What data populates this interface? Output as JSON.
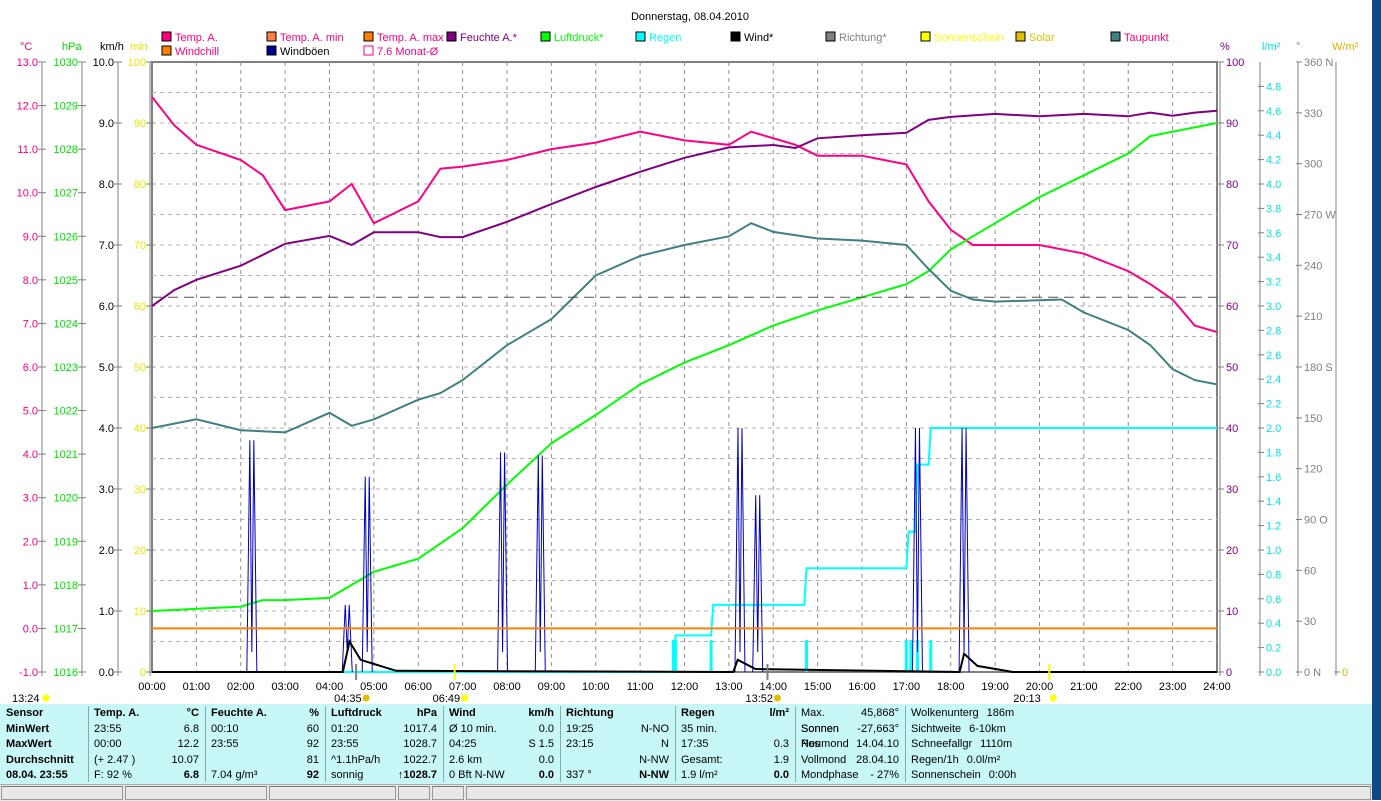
{
  "chart_data": {
    "type": "line",
    "title": "Donnerstag, 08.04.2010",
    "legend": [
      {
        "label": "Temp. A.",
        "color": "#ff0080",
        "text": "#ff0080"
      },
      {
        "label": "Temp. A. min",
        "color": "#ff8040",
        "text": "#ff0080"
      },
      {
        "label": "Temp. A. max",
        "color": "#ff8000",
        "text": "#ff0080"
      },
      {
        "label": "Feuchte A.*",
        "color": "#800080",
        "text": "#800080"
      },
      {
        "label": "Luftdruck*",
        "color": "#00ff00",
        "text": "#00ff00"
      },
      {
        "label": "Regen",
        "color": "#00ffff",
        "text": "#00ffff"
      },
      {
        "label": "Wind*",
        "color": "#000000",
        "text": "#000000"
      },
      {
        "label": "Richtung*",
        "color": "#808080",
        "text": "#808080"
      },
      {
        "label": "Sonnenschein",
        "color": "#ffff00",
        "text": "#ffff00"
      },
      {
        "label": "Solar",
        "color": "#e0c000",
        "text": "#e0c000"
      },
      {
        "label": "Taupunkt",
        "color": "#408080",
        "text": "#ff0080"
      },
      {
        "label": "Windchill",
        "color": "#ff8000",
        "text": "#ff0080"
      },
      {
        "label": "Windböen",
        "color": "#000090",
        "text": "#000000"
      },
      {
        "label": "7.6 Monat-Ø",
        "color": "#ff0080",
        "text": "#ff0080",
        "hollow": true
      }
    ],
    "x_ticks": [
      "00:00",
      "01:00",
      "02:00",
      "03:00",
      "04:00",
      "05:00",
      "06:00",
      "07:00",
      "08:00",
      "09:00",
      "10:00",
      "11:00",
      "12:00",
      "13:00",
      "14:00",
      "15:00",
      "16:00",
      "17:00",
      "18:00",
      "19:00",
      "20:00",
      "21:00",
      "22:00",
      "23:00",
      "24:00"
    ],
    "xlim": [
      0,
      24
    ],
    "axes_left": [
      {
        "unit": "°C",
        "color": "#ff0080",
        "range": [
          -1,
          13
        ],
        "ticks": [
          "-1.0",
          "0.0",
          "1.0",
          "2.0",
          "3.0",
          "4.0",
          "5.0",
          "6.0",
          "7.0",
          "8.0",
          "9.0",
          "10.0",
          "11.0",
          "12.0",
          "13.0"
        ]
      },
      {
        "unit": "hPa",
        "color": "#00e000",
        "range": [
          1016,
          1030
        ],
        "ticks": [
          "1016",
          "1017",
          "1018",
          "1019",
          "1020",
          "1021",
          "1022",
          "1023",
          "1024",
          "1025",
          "1026",
          "1027",
          "1028",
          "1029",
          "1030"
        ]
      },
      {
        "unit": "km/h",
        "color": "#000000",
        "range": [
          0,
          10
        ],
        "ticks": [
          "0.0",
          "1.0",
          "2.0",
          "3.0",
          "4.0",
          "5.0",
          "6.0",
          "7.0",
          "8.0",
          "9.0",
          "10.0"
        ]
      },
      {
        "unit": "min",
        "color": "#e8e800",
        "range": [
          0,
          100
        ],
        "ticks": [
          "0",
          "10",
          "20",
          "30",
          "40",
          "50",
          "60",
          "70",
          "80",
          "90",
          "100"
        ]
      }
    ],
    "axes_right": [
      {
        "unit": "%",
        "color": "#800080",
        "range": [
          0,
          100
        ],
        "ticks": [
          "0",
          "10",
          "20",
          "30",
          "40",
          "50",
          "60",
          "70",
          "80",
          "90",
          "100"
        ]
      },
      {
        "unit": "l/m²",
        "color": "#00e8e8",
        "range": [
          0,
          5
        ],
        "ticks": [
          "0.0",
          "0.2",
          "0.4",
          "0.6",
          "0.8",
          "1.0",
          "1.2",
          "1.4",
          "1.6",
          "1.8",
          "2.0",
          "2.2",
          "2.4",
          "2.6",
          "2.8",
          "3.0",
          "3.2",
          "3.4",
          "3.6",
          "3.8",
          "4.0",
          "4.2",
          "4.4",
          "4.6",
          "4.8"
        ]
      },
      {
        "unit": "°",
        "color": "#808080",
        "range": [
          0,
          360
        ],
        "ticks": [
          "0 N",
          "30",
          "60",
          "90 O",
          "120",
          "150",
          "180 S",
          "210",
          "240",
          "270 W",
          "300",
          "330",
          "360 N"
        ]
      },
      {
        "unit": "W/m²",
        "color": "#e0b000",
        "range": [
          0,
          100
        ],
        "ticks": [
          "0"
        ]
      }
    ],
    "series": [
      {
        "name": "Temp. A.",
        "axis": "°C",
        "color": "#ff0080",
        "points": [
          [
            0,
            12.2
          ],
          [
            0.5,
            11.55
          ],
          [
            1,
            11.1
          ],
          [
            2,
            10.75
          ],
          [
            2.5,
            10.4
          ],
          [
            3,
            9.6
          ],
          [
            4,
            9.8
          ],
          [
            4.5,
            10.2
          ],
          [
            5,
            9.3
          ],
          [
            6,
            9.8
          ],
          [
            6.5,
            10.55
          ],
          [
            7,
            10.6
          ],
          [
            8,
            10.75
          ],
          [
            9,
            11.0
          ],
          [
            10,
            11.15
          ],
          [
            11,
            11.4
          ],
          [
            12,
            11.2
          ],
          [
            13,
            11.1
          ],
          [
            13.5,
            11.4
          ],
          [
            14.5,
            11.1
          ],
          [
            15,
            10.85
          ],
          [
            16,
            10.85
          ],
          [
            17,
            10.65
          ],
          [
            17.5,
            9.8
          ],
          [
            18,
            9.15
          ],
          [
            18.5,
            8.8
          ],
          [
            20,
            8.8
          ],
          [
            21,
            8.6
          ],
          [
            22,
            8.2
          ],
          [
            22.5,
            7.9
          ],
          [
            23,
            7.55
          ],
          [
            23.5,
            6.95
          ],
          [
            24,
            6.8
          ]
        ]
      },
      {
        "name": "Feuchte A.*",
        "axis": "%",
        "color": "#800080",
        "points": [
          [
            0,
            60
          ],
          [
            0.5,
            62.6
          ],
          [
            1,
            64.3
          ],
          [
            2,
            66.6
          ],
          [
            2.5,
            68.4
          ],
          [
            3,
            70.2
          ],
          [
            4,
            71.5
          ],
          [
            4.5,
            70
          ],
          [
            5,
            72.1
          ],
          [
            6,
            72.1
          ],
          [
            6.5,
            71.3
          ],
          [
            7,
            71.3
          ],
          [
            8,
            73.8
          ],
          [
            9,
            76.7
          ],
          [
            10,
            79.5
          ],
          [
            11,
            82
          ],
          [
            12,
            84.3
          ],
          [
            13,
            86
          ],
          [
            14,
            86.4
          ],
          [
            14.5,
            85.9
          ],
          [
            15,
            87.5
          ],
          [
            16,
            88
          ],
          [
            17,
            88.4
          ],
          [
            17.5,
            90.5
          ],
          [
            18,
            91
          ],
          [
            19,
            91.5
          ],
          [
            20,
            91.1
          ],
          [
            21,
            91.5
          ],
          [
            22,
            91.1
          ],
          [
            22.5,
            91.7
          ],
          [
            23,
            91.2
          ],
          [
            23.5,
            91.7
          ],
          [
            24,
            92
          ]
        ]
      },
      {
        "name": "Luftdruck*",
        "axis": "hPa",
        "color": "#00ff00",
        "points": [
          [
            0,
            1017.4
          ],
          [
            2,
            1017.5
          ],
          [
            2.5,
            1017.65
          ],
          [
            3,
            1017.65
          ],
          [
            4,
            1017.7
          ],
          [
            4.5,
            1018.0
          ],
          [
            5,
            1018.3
          ],
          [
            6,
            1018.6
          ],
          [
            7,
            1019.3
          ],
          [
            8,
            1020.3
          ],
          [
            9,
            1021.25
          ],
          [
            10,
            1021.9
          ],
          [
            11,
            1022.6
          ],
          [
            12,
            1023.1
          ],
          [
            13,
            1023.5
          ],
          [
            14,
            1023.95
          ],
          [
            15,
            1024.3
          ],
          [
            16,
            1024.6
          ],
          [
            17,
            1024.9
          ],
          [
            17.5,
            1025.2
          ],
          [
            18,
            1025.7
          ],
          [
            19,
            1026.3
          ],
          [
            20,
            1026.9
          ],
          [
            21,
            1027.4
          ],
          [
            22,
            1027.9
          ],
          [
            22.5,
            1028.3
          ],
          [
            23,
            1028.4
          ],
          [
            24,
            1028.6
          ]
        ]
      },
      {
        "name": "Taupunkt",
        "axis": "°C",
        "color": "#408080",
        "points": [
          [
            0,
            4.6
          ],
          [
            1,
            4.8
          ],
          [
            2,
            4.55
          ],
          [
            3,
            4.5
          ],
          [
            4,
            4.95
          ],
          [
            4.5,
            4.65
          ],
          [
            5,
            4.8
          ],
          [
            6,
            5.25
          ],
          [
            6.5,
            5.4
          ],
          [
            7,
            5.7
          ],
          [
            8,
            6.5
          ],
          [
            9,
            7.1
          ],
          [
            10,
            8.1
          ],
          [
            11,
            8.55
          ],
          [
            12,
            8.8
          ],
          [
            13,
            9.0
          ],
          [
            13.5,
            9.3
          ],
          [
            14,
            9.1
          ],
          [
            15,
            8.95
          ],
          [
            16,
            8.9
          ],
          [
            17,
            8.8
          ],
          [
            17.5,
            8.25
          ],
          [
            18,
            7.75
          ],
          [
            18.5,
            7.55
          ],
          [
            19,
            7.5
          ],
          [
            20.5,
            7.55
          ],
          [
            21,
            7.25
          ],
          [
            22,
            6.85
          ],
          [
            22.5,
            6.5
          ],
          [
            23,
            5.95
          ],
          [
            23.5,
            5.7
          ],
          [
            24,
            5.6
          ]
        ]
      },
      {
        "name": "Regen",
        "axis": "l/m²",
        "color": "#00ffff",
        "step": true,
        "points": [
          [
            0,
            0
          ],
          [
            11.75,
            0
          ],
          [
            11.8,
            0.3
          ],
          [
            12.6,
            0.3
          ],
          [
            12.65,
            0.55
          ],
          [
            14.7,
            0.55
          ],
          [
            14.75,
            0.85
          ],
          [
            17.0,
            0.85
          ],
          [
            17.05,
            1.15
          ],
          [
            17.2,
            1.15
          ],
          [
            17.25,
            1.7
          ],
          [
            17.5,
            1.7
          ],
          [
            17.55,
            2.0
          ],
          [
            24,
            2.0
          ]
        ]
      },
      {
        "name": "Windböen",
        "axis": "km/h",
        "color": "#0000c0",
        "spikes": true,
        "points": [
          [
            2.25,
            3.8
          ],
          [
            4.4,
            1.1
          ],
          [
            4.85,
            3.2
          ],
          [
            7.9,
            3.6
          ],
          [
            8.75,
            3.55
          ],
          [
            13.25,
            4.0
          ],
          [
            13.65,
            2.9
          ],
          [
            17.25,
            4.0
          ],
          [
            18.3,
            4.0
          ]
        ]
      },
      {
        "name": "Wind*",
        "axis": "km/h",
        "color": "#000000",
        "points": [
          [
            0,
            0
          ],
          [
            4.3,
            0
          ],
          [
            4.45,
            0.5
          ],
          [
            4.7,
            0.2
          ],
          [
            5.5,
            0.02
          ],
          [
            13.1,
            0
          ],
          [
            13.2,
            0.2
          ],
          [
            13.6,
            0.05
          ],
          [
            18.2,
            0
          ],
          [
            18.3,
            0.3
          ],
          [
            18.6,
            0.1
          ],
          [
            19.4,
            0
          ],
          [
            24,
            0
          ]
        ]
      },
      {
        "name": "Windchill",
        "axis": "°C",
        "color": "#ff8000",
        "points": [
          [
            0,
            0.0
          ],
          [
            24,
            0.0
          ]
        ]
      },
      {
        "name": "7.6 Monat-Ø",
        "axis": "°C",
        "color": "#505050",
        "dashed": true,
        "points": [
          [
            0,
            7.6
          ],
          [
            24,
            7.6
          ]
        ]
      }
    ],
    "rain_rate_marks": [
      11.75,
      11.8,
      12.6,
      14.75,
      17.0,
      17.1,
      17.25,
      17.55
    ],
    "markers": [
      {
        "label": "13:24",
        "hour": -2.9,
        "icon": "moon"
      },
      {
        "label": "04:35",
        "hour": 4.6,
        "icon": "moonrise"
      },
      {
        "label": "06:49",
        "hour": 6.82,
        "icon": "sunrise"
      },
      {
        "label": "13:52",
        "hour": 13.87,
        "icon": "moonset"
      },
      {
        "label": "20:13",
        "hour": 20.22,
        "icon": "sunset"
      }
    ]
  },
  "stats": {
    "sensor": {
      "head": "Sensor",
      "rows": [
        "MinWert",
        "MaxWert",
        "Durchschnitt",
        "08.04. 23:55"
      ]
    },
    "temp": {
      "head": "Temp. A.",
      "unit": "°C",
      "rows": [
        [
          "23:55",
          "6.8"
        ],
        [
          "00:00",
          "12.2"
        ],
        [
          "(+ 2.47 )",
          "10.07"
        ],
        [
          "F: 92 %",
          "6.8"
        ]
      ]
    },
    "feuchte": {
      "head": "Feuchte A.",
      "unit": "%",
      "rows": [
        [
          "00:10",
          "60"
        ],
        [
          "23:55",
          "92"
        ],
        [
          "",
          "81"
        ],
        [
          "7.04 g/m³",
          "92"
        ]
      ]
    },
    "luftdruck": {
      "head": "Luftdruck",
      "unit": "hPa",
      "rows": [
        [
          "01:20",
          "1017.4"
        ],
        [
          "23:55",
          "1028.7"
        ],
        [
          "^1.1hPa/h",
          "1022.7"
        ],
        [
          "sonnig",
          "↑1028.7"
        ]
      ]
    },
    "wind": {
      "head": "Wind",
      "unit": "km/h",
      "rows": [
        [
          "Ø 10 min.",
          "0.0"
        ],
        [
          "04:25",
          "S 1.5"
        ],
        [
          "2.6 km",
          "0.0"
        ],
        [
          "0 Bft N-NW",
          "0.0"
        ]
      ]
    },
    "richtung": {
      "head": "Richtung",
      "unit": "",
      "rows": [
        [
          "19:25",
          "N-NO"
        ],
        [
          "23:15",
          "N"
        ],
        [
          "",
          "N-NW"
        ],
        [
          "337 °",
          "N-NW"
        ]
      ]
    },
    "regen": {
      "head": "Regen",
      "unit": "l/m²",
      "rows": [
        [
          "35 min.",
          ""
        ],
        [
          "17:35",
          "0.3"
        ],
        [
          "Gesamt:",
          "1.9"
        ],
        [
          "1.9 l/m²",
          "0.0"
        ]
      ]
    },
    "sonne": {
      "rows": [
        [
          "Max. Sonnen",
          "45,868°"
        ],
        [
          "Sonnen Pos",
          "-27,663°"
        ],
        [
          "Neumond",
          "14.04.10"
        ],
        [
          "Vollmond",
          "28.04.10"
        ],
        [
          "Mondphase",
          "- 27%"
        ]
      ]
    },
    "wolken": {
      "rows": [
        [
          "Wolkenunterg",
          "186m"
        ],
        [
          "Sichtweite",
          "6-10km"
        ],
        [
          "Schneefallgr",
          "1110m"
        ],
        [
          "Regen/1h",
          "0.0l/m²"
        ],
        [
          "Sonnenschein",
          "0:00h"
        ]
      ]
    }
  }
}
